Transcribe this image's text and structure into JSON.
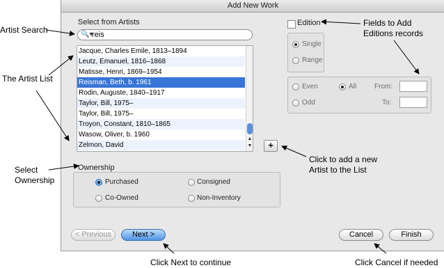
{
  "window": {
    "title": "Add New Work"
  },
  "artists": {
    "section_label": "Select from Artists",
    "search_value": "reis",
    "items": [
      "Jacque, Charles Emile, 1813–1894",
      "Leutz, Emanuel, 1816–1868",
      "Matisse, Henri, 1869–1954",
      "Reisman, Beth, b. 1961",
      "Rodin, Auguste, 1840–1917",
      "Taylor, Bill, 1975–",
      "Taylor, Bill, 1975–",
      "Troyon, Constant, 1810–1865",
      "Wasow, Oliver, b. 1960",
      "Zelmon, David"
    ],
    "selected_index": 3,
    "add_button": "+"
  },
  "edition": {
    "checkbox_label": "Edition",
    "checked": false,
    "single_label": "Single",
    "range_label": "Range",
    "even_label": "Even",
    "all_label": "All",
    "odd_label": "Odd",
    "from_label": "From:",
    "to_label": "To:",
    "from_value": "",
    "to_value": ""
  },
  "ownership": {
    "label": "Ownership",
    "options": [
      "Purchased",
      "Consigned",
      "Co-Owned",
      "Non-Inventory"
    ],
    "selected": "Purchased"
  },
  "buttons": {
    "previous": "< Previous",
    "next": "Next >",
    "cancel": "Cancel",
    "finish": "Finish"
  },
  "annotations": {
    "artist_search": "Artist Search",
    "artist_list": "The Artist List",
    "select_ownership_1": "Select",
    "select_ownership_2": "Ownership",
    "fields_editions_1": "Fields to Add",
    "fields_editions_2": "Editions records",
    "add_artist_1": "Click to add a new",
    "add_artist_2": "Artist to the List",
    "click_next": "Click Next to continue",
    "click_cancel": "Click Cancel if needed"
  },
  "colors": {
    "selection": "#3875d7",
    "default_button": "#5b9be6",
    "dialog_bg": "#e8e8e8"
  }
}
